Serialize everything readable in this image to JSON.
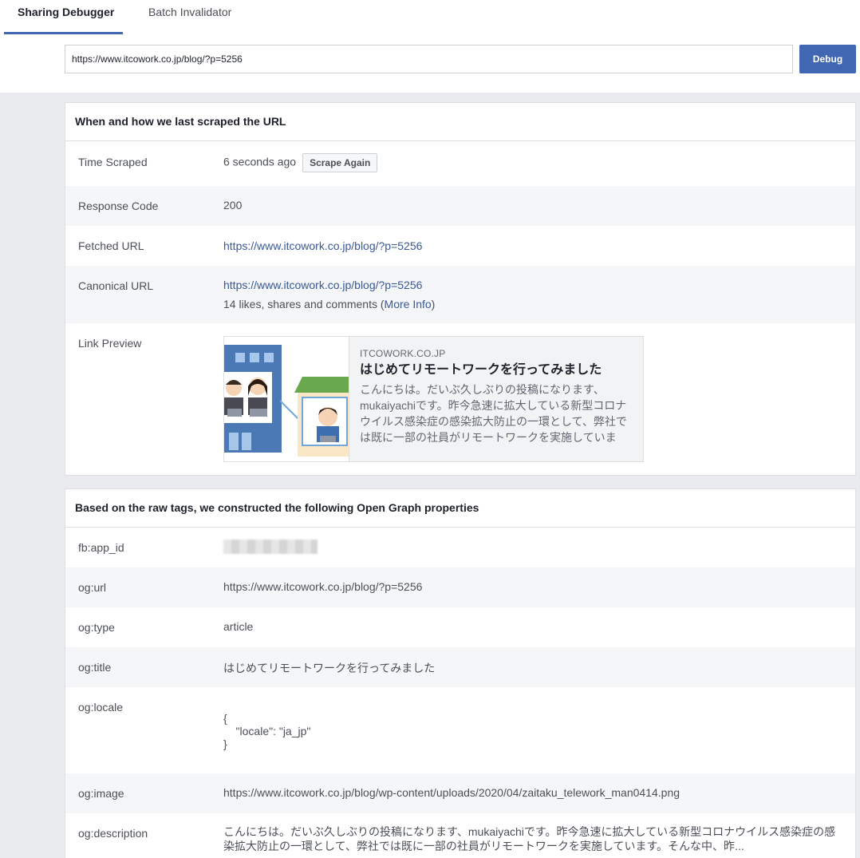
{
  "tabs": [
    {
      "label": "Sharing Debugger"
    },
    {
      "label": "Batch Invalidator"
    }
  ],
  "search": {
    "value": "https://www.itcowork.co.jp/blog/?p=5256",
    "button_label": "Debug"
  },
  "scrape_panel": {
    "title": "When and how we last scraped the URL",
    "time_scraped_label": "Time Scraped",
    "time_scraped_value": "6 seconds ago",
    "scrape_again_label": "Scrape Again",
    "response_code_label": "Response Code",
    "response_code_value": "200",
    "fetched_url_label": "Fetched URL",
    "fetched_url_value": "https://www.itcowork.co.jp/blog/?p=5256",
    "canonical_url_label": "Canonical URL",
    "canonical_url_value": "https://www.itcowork.co.jp/blog/?p=5256",
    "engagement_prefix": "14 likes, shares and comments (",
    "more_info_label": "More Info",
    "engagement_suffix": ")",
    "link_preview_label": "Link Preview",
    "preview": {
      "domain": "ITCOWORK.CO.JP",
      "title": "はじめてリモートワークを行ってみました",
      "description": "こんにちは。だいぶ久しぶりの投稿になります、mukaiyachiです。昨今急速に拡大している新型コロナウイルス感染症の感染拡大防止の一環として、弊社では既に一部の社員がリモートワークを実施していま"
    }
  },
  "og_panel": {
    "title": "Based on the raw tags, we constructed the following Open Graph properties",
    "rows": [
      {
        "label": "fb:app_id",
        "value": ""
      },
      {
        "label": "og:url",
        "value": "https://www.itcowork.co.jp/blog/?p=5256"
      },
      {
        "label": "og:type",
        "value": "article"
      },
      {
        "label": "og:title",
        "value": "はじめてリモートワークを行ってみました"
      },
      {
        "label": "og:locale",
        "value": "{\n    \"locale\": \"ja_jp\"\n}"
      },
      {
        "label": "og:image",
        "value": "https://www.itcowork.co.jp/blog/wp-content/uploads/2020/04/zaitaku_telework_man0414.png"
      },
      {
        "label": "og:description",
        "value": "こんにちは。だいぶ久しぶりの投稿になります、mukaiyachiです。昨今急速に拡大している新型コロナウイルス感染症の感染拡大防止の一環として、弊社では既に一部の社員がリモートワークを実施しています。そんな中、昨..."
      }
    ]
  },
  "colors": {
    "accent": "#4267b2",
    "link": "#385898",
    "page_bg": "#e9ebee"
  }
}
